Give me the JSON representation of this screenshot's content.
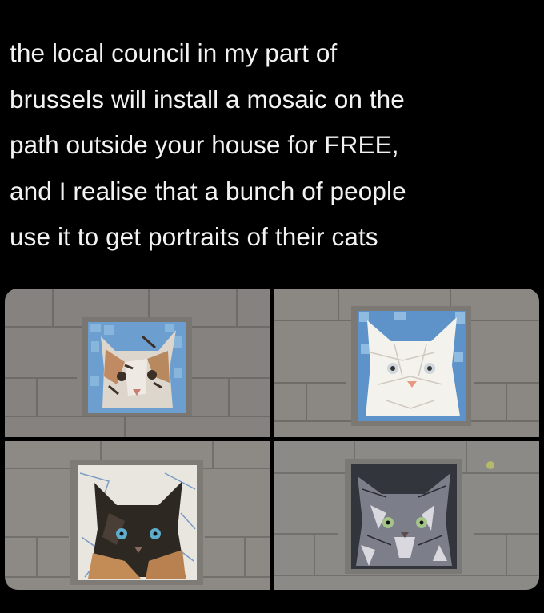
{
  "post": {
    "lines": [
      "the local council in my part of",
      "brussels will install a mosaic on the",
      "path outside your house for FREE,",
      "and I realise that a bunch of people",
      "use it to get portraits of their cats"
    ]
  },
  "photos": [
    {
      "icon": "calico-cat-mosaic",
      "cat_colors": [
        "#c9b8a8",
        "#e8e2da",
        "#4a3a2e"
      ],
      "background": "#6f9ec9"
    },
    {
      "icon": "white-cat-mosaic",
      "cat_colors": [
        "#f3f1ec",
        "#e2ddd5",
        "#9aa"
      ],
      "background": "#5f93c7"
    },
    {
      "icon": "siamese-cat-mosaic",
      "cat_colors": [
        "#2a2420",
        "#c08a54",
        "#5fa8c8"
      ],
      "background": "#e6e2dc"
    },
    {
      "icon": "grey-fluffy-cat-mosaic",
      "cat_colors": [
        "#7a7c86",
        "#d6d6dc",
        "#2c2c34"
      ],
      "background": "#34363e"
    }
  ],
  "colors": {
    "background": "#000000",
    "text": "#f2f2f2",
    "pavement": "#8a8784"
  }
}
